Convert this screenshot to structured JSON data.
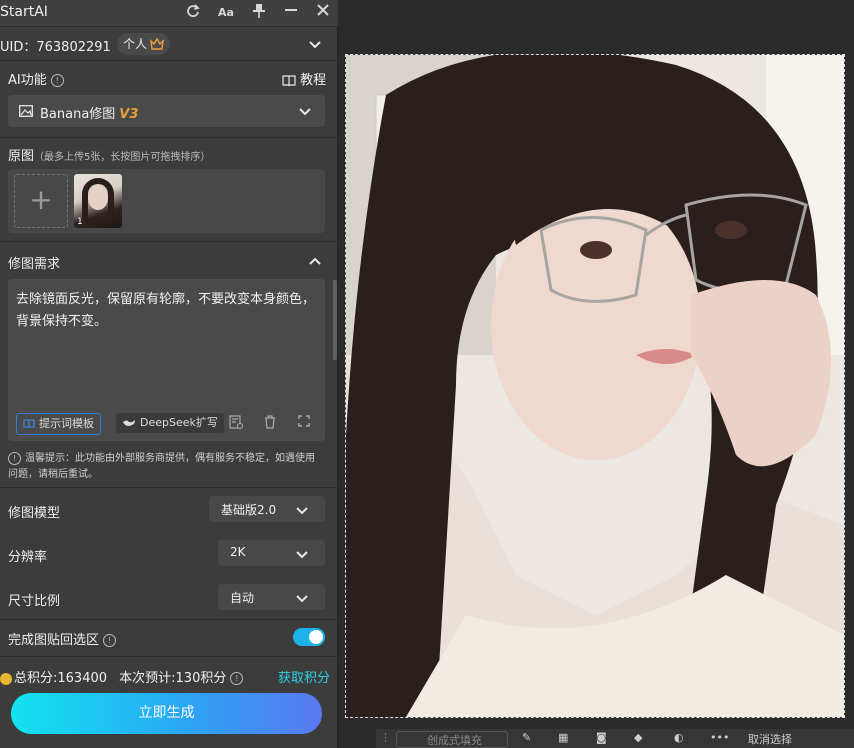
{
  "app": {
    "title": "StartAI"
  },
  "titlebar": {
    "icons": [
      "refresh-icon",
      "font-size-icon",
      "pin-icon",
      "minimize-icon",
      "close-icon"
    ],
    "font_label": "Aa"
  },
  "account": {
    "uid": "UID：763802291",
    "plan_badge": "个人"
  },
  "ai_function": {
    "label": "AI功能",
    "tutorial": "教程",
    "selected": "Banana修图",
    "version": "V3"
  },
  "original": {
    "label": "原图",
    "hint": "（最多上传5张，长按图片可拖拽排序）",
    "thumb_index": "1"
  },
  "requirement": {
    "label": "修图需求",
    "text": "去除镜面反光，保留原有轮廓，不要改变本身颜色，背景保持不变。",
    "template_button": "提示词模板",
    "deepseek_button": "DeepSeek扩写"
  },
  "tip": "温馨提示：此功能由外部服务商提供，偶有服务不稳定，如遇使用问题，请稍后重试。",
  "settings": {
    "model": {
      "label": "修图模型",
      "value": "基础版2.0"
    },
    "resolution": {
      "label": "分辨率",
      "value": "2K"
    },
    "ratio": {
      "label": "尺寸比例",
      "value": "自动"
    },
    "paste_back": {
      "label": "完成图贴回选区",
      "enabled": true
    }
  },
  "points": {
    "total": "总积分:163400",
    "estimate": "本次预计:130积分",
    "get": "获取积分"
  },
  "generate_button": "立即生成",
  "bottom_toolbar": {
    "fill_label": "创成式填充",
    "cancel_label": "取消选择"
  },
  "colors": {
    "accent": "#1db3e8",
    "version": "#e8a23a",
    "button_start": "#12e3f0",
    "button_end": "#5a78f0"
  }
}
